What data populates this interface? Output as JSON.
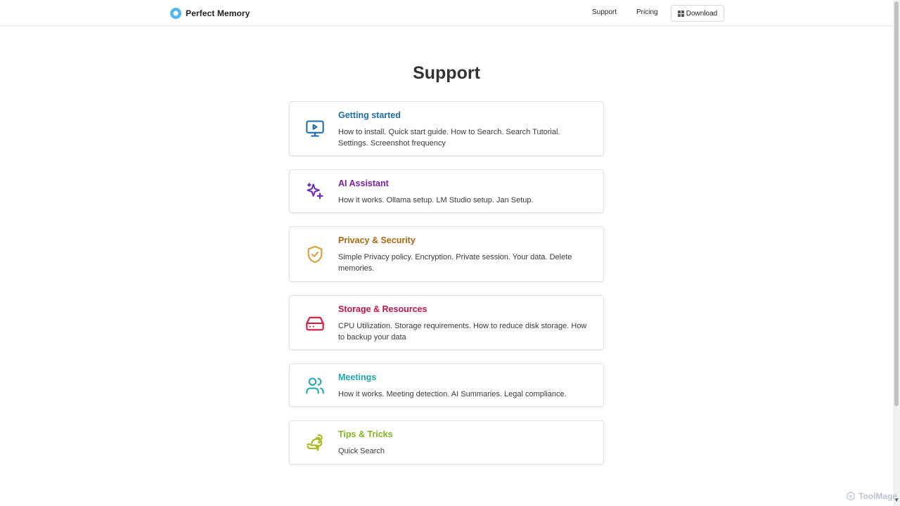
{
  "header": {
    "brand_name": "Perfect Memory",
    "nav": {
      "support": "Support",
      "pricing": "Pricing",
      "download": "Download"
    }
  },
  "main": {
    "title": "Support",
    "cards": [
      {
        "title": "Getting started",
        "description": "How to install. Quick start guide. How to Search. Search Tutorial. Settings. Screenshot frequency",
        "color": "#1b6fa8",
        "icon": "monitor-play-icon"
      },
      {
        "title": "AI Assistant",
        "description": "How it works. Ollama setup. LM Studio setup. Jan Setup.",
        "color": "#7a1fa2",
        "icon": "sparkles-icon"
      },
      {
        "title": "Privacy & Security",
        "description": "Simple Privacy policy. Encryption. Private session. Your data. Delete memories.",
        "color": "#a66a10",
        "icon": "shield-check-icon"
      },
      {
        "title": "Storage & Resources",
        "description": "CPU Utilization. Storage requirements. How to reduce disk storage. How to backup your data",
        "color": "#c4124f",
        "icon": "hard-drive-icon"
      },
      {
        "title": "Meetings",
        "description": "How it works. Meeting detection. AI Summaries. Legal compliance.",
        "color": "#1fa9b0",
        "icon": "users-icon"
      },
      {
        "title": "Tips & Tricks",
        "description": "Quick Search",
        "color": "#7fb51e",
        "icon": "rabbit-icon"
      }
    ]
  },
  "watermark": {
    "text": "ToolMage"
  },
  "colors": {
    "logo": "#4fb8ee",
    "card_border": "#e2e2e2",
    "text": "#333333"
  }
}
